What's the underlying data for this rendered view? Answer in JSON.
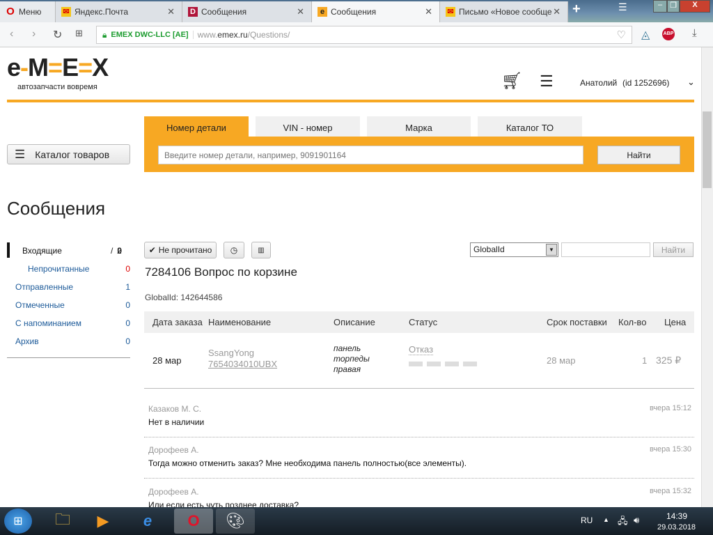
{
  "browser": {
    "tabs": [
      {
        "label": "Меню"
      },
      {
        "label": "Яндекс.Почта"
      },
      {
        "label": "Сообщения"
      },
      {
        "label": "Сообщения"
      },
      {
        "label": "Письмо «Новое сообще"
      }
    ],
    "cert": "EMEX DWC-LLC [AE]",
    "url_prefix": "www.",
    "url_domain": "emex.ru",
    "url_path": "/Questions/",
    "abp": "ABP"
  },
  "header": {
    "logo": "e-M-E-X",
    "tagline": "автозапчасти вовремя",
    "user": "Анатолий",
    "user_id": "(id 1252696)"
  },
  "catalog_button": "Каталог товаров",
  "search": {
    "tabs": [
      "Номер детали",
      "VIN - номер",
      "Марка",
      "Каталог ТО"
    ],
    "placeholder": "Введите номер детали, например, 9091901164",
    "button": "Найти"
  },
  "page_title": "Сообщения",
  "sidebar": {
    "items": [
      {
        "label": "Входящие",
        "count": "0",
        "total": "2"
      },
      {
        "label": "Непрочитанные",
        "count": "0"
      },
      {
        "label": "Отправленные",
        "count": "1"
      },
      {
        "label": "Отмеченные",
        "count": "0"
      },
      {
        "label": "С напоминанием",
        "count": "0"
      },
      {
        "label": "Архив",
        "count": "0"
      }
    ]
  },
  "toolbar": {
    "unread_button": "Не прочитано",
    "filter_select": "GlobalId",
    "filter_value": "",
    "find_button": "Найти"
  },
  "question": {
    "title": "7284106 Вопрос по корзине",
    "global_id": "GlobalId: 142644586"
  },
  "table": {
    "headers": [
      "Дата заказа",
      "Наименование",
      "Описание",
      "Статус",
      "Срок поставки",
      "Кол-во",
      "Цена"
    ],
    "row": {
      "date": "28 мар",
      "brand": "SsangYong",
      "part": "7654034010UBX",
      "desc1": "панель",
      "desc2": "торпеды",
      "desc3": "правая",
      "status": "Отказ",
      "delivery": "28 мар",
      "qty": "1",
      "price": "325 ₽"
    }
  },
  "messages": [
    {
      "author": "Казаков М. С.",
      "time": "вчера 15:12",
      "text": "Нет в наличии"
    },
    {
      "author": "Дорофеев А.",
      "time": "вчера 15:30",
      "text": "Тогда можно отменить заказ? Мне необходима панель полностью(все элементы)."
    },
    {
      "author": "Дорофеев А.",
      "time": "вчера 15:32",
      "text": "Или если есть чуть позднее доставка?"
    }
  ],
  "taskbar": {
    "lang": "RU",
    "time": "14:39",
    "date": "29.03.2018"
  }
}
